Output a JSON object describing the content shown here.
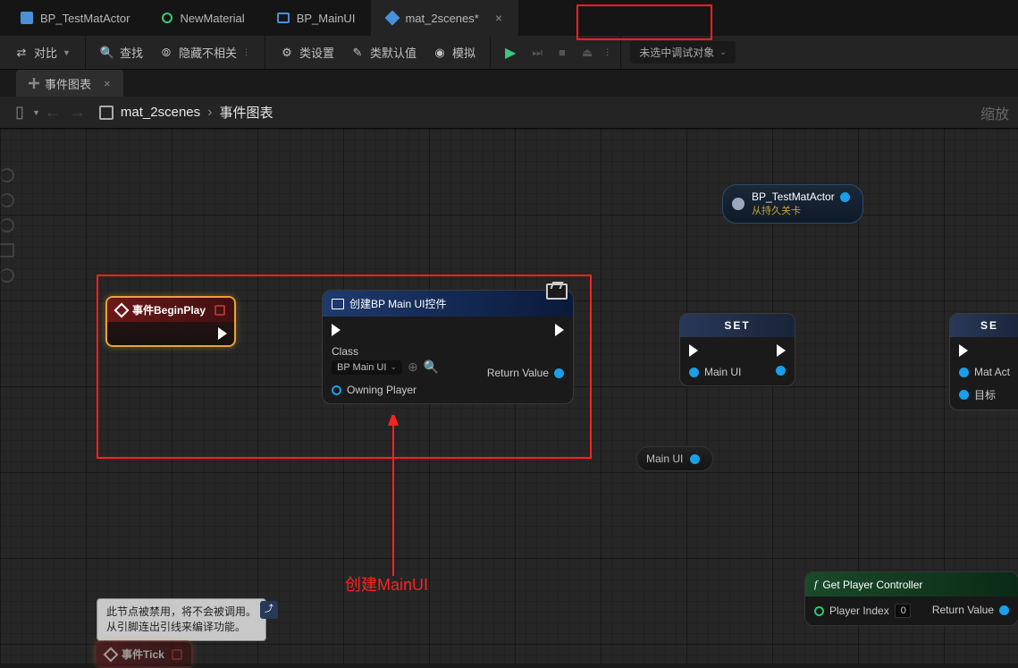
{
  "tabs": [
    {
      "label": "BP_TestMatActor",
      "icon": "bp"
    },
    {
      "label": "NewMaterial",
      "icon": "mat"
    },
    {
      "label": "BP_MainUI",
      "icon": "ui"
    },
    {
      "label": "mat_2scenes*",
      "icon": "level",
      "active": true,
      "closeable": true
    }
  ],
  "toolbar": {
    "compare": "对比",
    "search": "查找",
    "hide_unrelated": "隐藏不相关",
    "class_settings": "类设置",
    "class_defaults": "类默认值",
    "simulate": "模拟",
    "debug_target": "未选中调试对象"
  },
  "sub_tab": {
    "label": "事件图表"
  },
  "breadcrumb": {
    "asset": "mat_2scenes",
    "graph": "事件图表",
    "zoom": "缩放"
  },
  "nodes": {
    "begin_play": {
      "title": "事件BeginPlay"
    },
    "create_widget": {
      "title": "创建BP Main UI控件",
      "class_label": "Class",
      "class_value": "BP Main UI",
      "owning_player": "Owning Player",
      "return_value": "Return Value"
    },
    "set1": {
      "title": "SET",
      "var": "Main UI"
    },
    "set2": {
      "title": "SE",
      "var1": "Mat Act",
      "var2": "目标"
    },
    "var_actor": {
      "label": "BP_TestMatActor",
      "sub": "从持久关卡"
    },
    "var_mainui": {
      "label": "Main UI"
    },
    "get_pc": {
      "title": "Get Player Controller",
      "player_index": "Player Index",
      "index_val": "0",
      "return_value": "Return Value"
    },
    "tick": {
      "title": "事件Tick"
    }
  },
  "tooltip": {
    "line1": "此节点被禁用，将不会被调用。",
    "line2": "从引脚连出引线来编译功能。"
  },
  "annotation": {
    "label": "创建MainUI"
  }
}
